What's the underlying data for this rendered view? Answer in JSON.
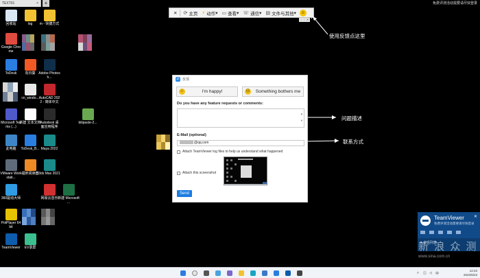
{
  "remote": {
    "tab_title": "TEXT01",
    "tab_close": "×",
    "new_tab": "+",
    "window_title": "免费评测活动需要请尽快登录"
  },
  "desktop_icons": [
    {
      "label": "回收站",
      "color": "#d9e7f5"
    },
    {
      "label": "log",
      "color": "#f1c232"
    },
    {
      "label": "m - 快捷方式",
      "color": "#f1c232"
    },
    {
      "label": "Google Chrome",
      "color": "#e04a3f"
    },
    {
      "label": "ToDesk",
      "color": "#2a7de1"
    },
    {
      "label": "向日葵",
      "color": "#f15a24"
    },
    {
      "label": "Adobe Photosh...",
      "color": "#0e2e4a"
    },
    {
      "label": "cn_windo...",
      "color": "#e8e8e8"
    },
    {
      "label": "AutoCAD 2022 - 简体中文",
      "color": "#c1272d"
    },
    {
      "label": "Microsoft Teams (...)",
      "color": "#5059c9"
    },
    {
      "label": "新建 文本文档",
      "color": "#ffffff"
    },
    {
      "label": "Autodesk 桌面应用程序",
      "color": "#2b2b2b"
    },
    {
      "label": "bilipaste-2...",
      "color": "#6aa84f"
    },
    {
      "label": "此电脑",
      "color": "#3d85c6"
    },
    {
      "label": "ToDesk_B...",
      "color": "#2a7de1"
    },
    {
      "label": "Maya 2022",
      "color": "#1b8a8a"
    },
    {
      "label": "VMware Workstati...",
      "color": "#5f6b7a"
    },
    {
      "label": "福昕阅读器",
      "color": "#f08a24"
    },
    {
      "label": "3ds Max 2021",
      "color": "#1b8a8a"
    },
    {
      "label": "360驱动大师",
      "color": "#2f9be5"
    },
    {
      "label": "网易云音乐",
      "color": "#d0302f"
    },
    {
      "label": "新建 Microsoft ...",
      "color": "#1d7044"
    },
    {
      "label": "PotPlayer 64 bit",
      "color": "#e6c200"
    },
    {
      "label": "TeamViewer",
      "color": "#0e5cad"
    },
    {
      "label": "EV录屏",
      "color": "#3cbf8f"
    }
  ],
  "toolbar": {
    "close": "✕",
    "home": "主页",
    "actions": "动作",
    "view": "查看",
    "communicate": "通信",
    "files_extras": "文件与其他",
    "handle": "⋮⋮ ✕"
  },
  "annotations": {
    "feedback_here": "使用反馈点这里",
    "problem_desc": "问题描述",
    "contact": "联系方式"
  },
  "dialog": {
    "title": "反馈",
    "happy": "I'm happy!",
    "bothers": "Something bothers me",
    "requests_label": "Do you have any feature requests or comments:",
    "email_label": "E-Mail (optional)",
    "email_value": "@qq.com",
    "attach_logs": "Attach TeamViewer log files to help us understand what happened",
    "attach_screenshot": "Attach this screenshot",
    "send": "Send"
  },
  "teamviewer_popup": {
    "name": "TeamViewer",
    "subtitle": "免费评测活动需要请尽快登录",
    "close": "✕",
    "footer": "▾ 会话列表"
  },
  "watermark": {
    "text": "新 浪 众 测",
    "sub": "www.sina.com.cn"
  },
  "tray": {
    "time": "12:23",
    "date": "2022/6/23"
  }
}
